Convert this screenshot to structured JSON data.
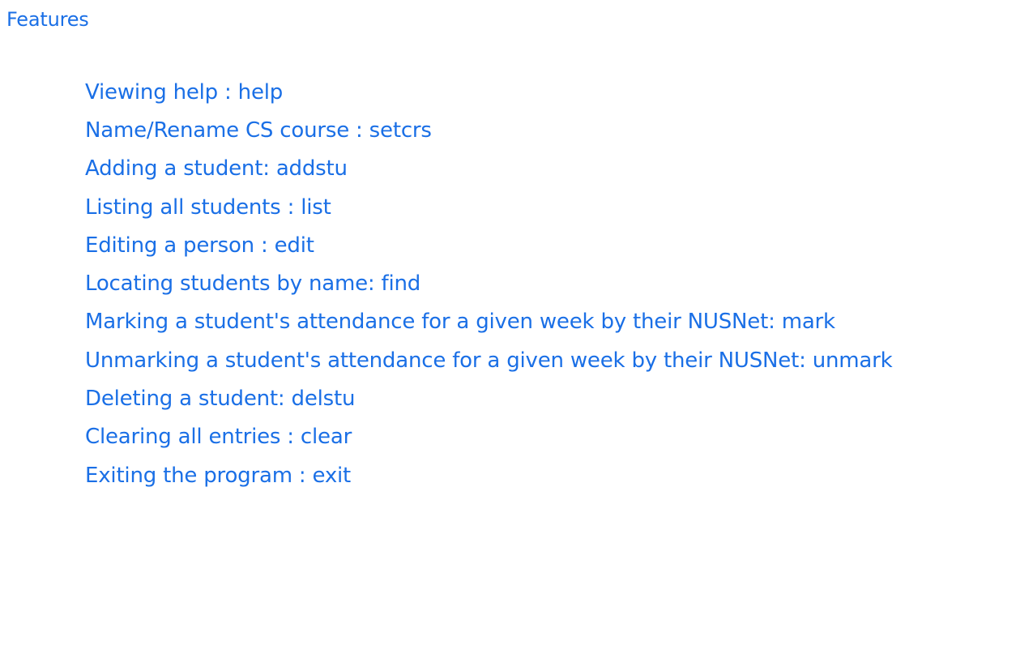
{
  "toc": {
    "section": "Features",
    "items": [
      "Viewing help : help",
      "Name/Rename CS course : setcrs",
      "Adding a student: addstu",
      "Listing all students : list",
      "Editing a person : edit",
      "Locating students by name: find",
      "Marking a student's attendance for a given week by their NUSNet: mark",
      "Unmarking a student's attendance for a given week by their NUSNet: unmark",
      "Deleting a student: delstu",
      "Clearing all entries : clear",
      "Exiting the program : exit"
    ]
  },
  "colors": {
    "link": "#1a6fe6",
    "background": "#ffffff"
  }
}
